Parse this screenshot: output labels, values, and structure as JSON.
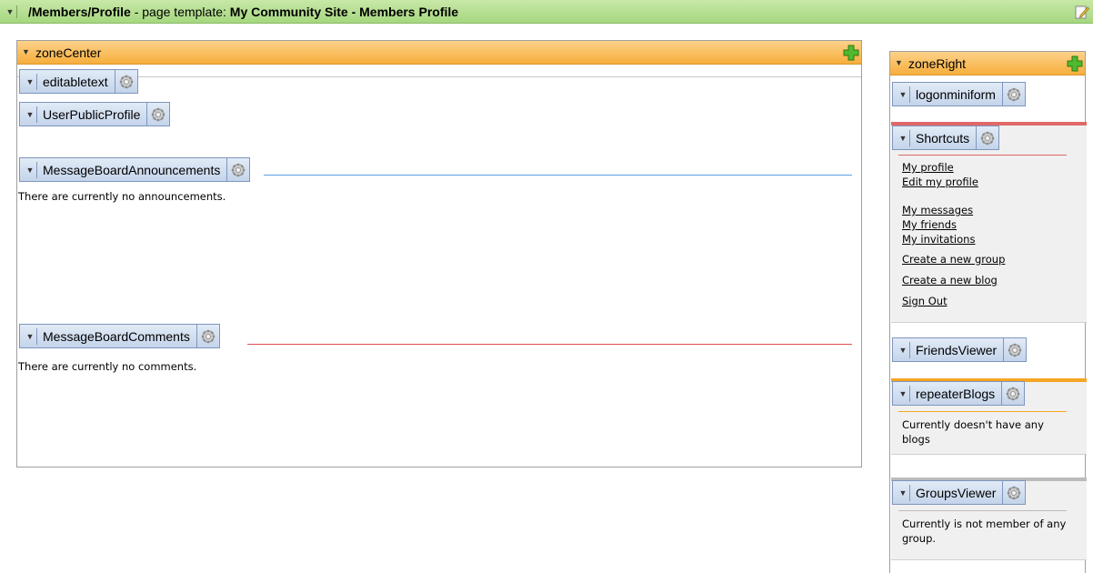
{
  "template_header": {
    "path": "/Members/Profile",
    "mid": " - page template: ",
    "template_name": "My Community Site - Members Profile"
  },
  "zone_center": {
    "title": "zoneCenter",
    "webparts": {
      "editabletext": "editabletext",
      "user_public_profile": "UserPublicProfile",
      "announcements": "MessageBoardAnnouncements",
      "comments": "MessageBoardComments"
    },
    "announcements_empty": "There are currently no announcements.",
    "comments_empty": "There are currently no comments."
  },
  "zone_right": {
    "title": "zoneRight",
    "webparts": {
      "logon": "logonminiform",
      "shortcuts": "Shortcuts",
      "friends": "FriendsViewer",
      "blogs": "repeaterBlogs",
      "groups": "GroupsViewer"
    },
    "shortcuts_links": {
      "my_profile": "My profile",
      "edit_profile": "Edit my profile",
      "my_messages": "My messages",
      "my_friends": "My friends",
      "my_invitations": "My invitations",
      "create_group": "Create a new group",
      "create_blog": "Create a new blog",
      "sign_out": "Sign Out"
    },
    "blogs_empty": "Currently doesn't have any blogs",
    "groups_empty": "Currently is not member of any group."
  },
  "colors": {
    "template_header": "#a6d77f",
    "zone_header": "#f6ae3c",
    "webpart_header": "#c4d4ea",
    "announcements_line": "#5aa0e0",
    "comments_line": "#e05050",
    "shortcuts_accent": "#e06868",
    "blogs_accent": "#f5a623",
    "groups_accent": "#bbbbbb"
  },
  "icons": {
    "collapse": "triangle-down-icon",
    "settings": "gear-icon",
    "add": "plus-icon",
    "edit": "edit-page-icon"
  }
}
